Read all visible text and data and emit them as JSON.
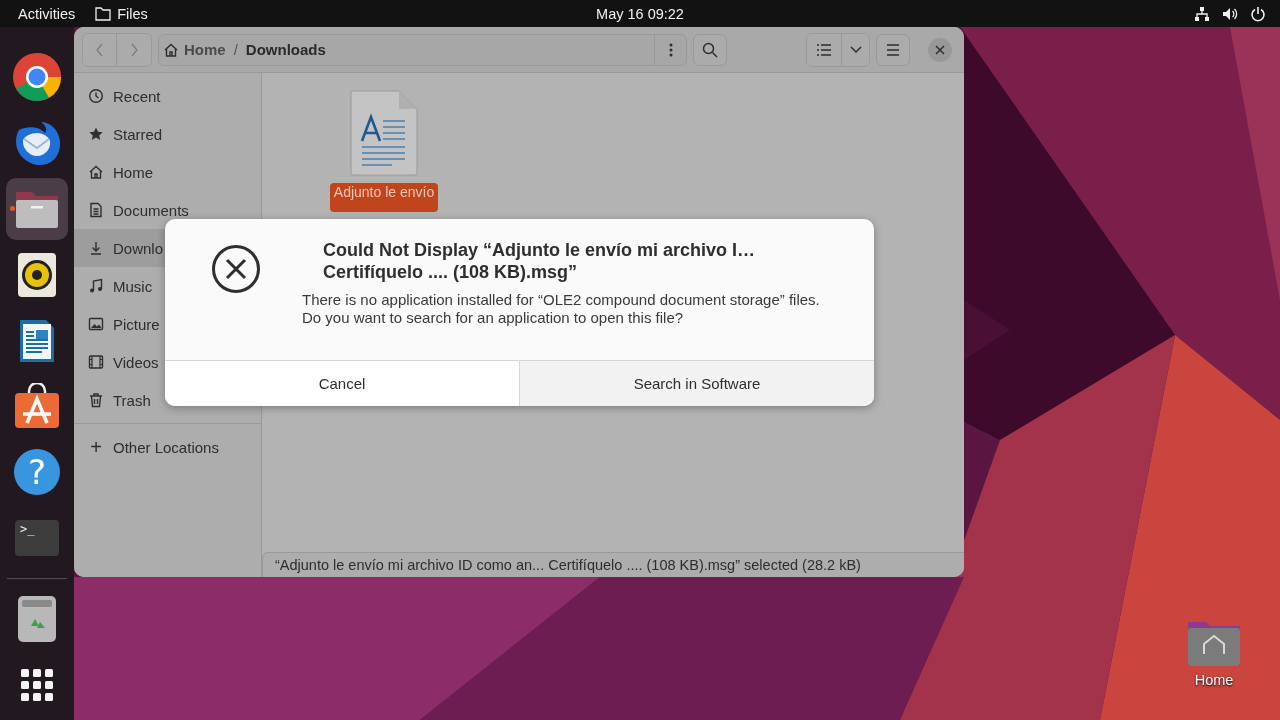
{
  "top_bar": {
    "activities": "Activities",
    "app_name": "Files",
    "clock": "May 16  09:22"
  },
  "dock": {
    "items": [
      {
        "kind": "chrome",
        "active": false
      },
      {
        "kind": "thunderbird",
        "active": false
      },
      {
        "kind": "files",
        "active": true
      },
      {
        "kind": "rhythmbox",
        "active": false
      },
      {
        "kind": "writer",
        "active": false
      },
      {
        "kind": "appcenter",
        "active": false
      },
      {
        "kind": "help",
        "glyph": "?",
        "active": false
      },
      {
        "kind": "terminal",
        "glyph": ">_",
        "active": false
      },
      {
        "kind": "separator"
      },
      {
        "kind": "trash",
        "active": false
      },
      {
        "kind": "apps",
        "active": false
      }
    ]
  },
  "window": {
    "nav": [
      {
        "kind": "back",
        "disabled": true
      },
      {
        "kind": "forward",
        "disabled": true
      }
    ],
    "path": [
      {
        "kind": "home",
        "label": "Home"
      },
      {
        "kind": "folder",
        "label": "Downloads"
      }
    ],
    "separator": "/",
    "sidebar": {
      "items": [
        {
          "label": "Recent",
          "selected": false
        },
        {
          "label": "Starred",
          "selected": false
        },
        {
          "label": "Home",
          "selected": false
        },
        {
          "label": "Documents",
          "selected": false
        },
        {
          "label": "Downlo",
          "selected": true
        },
        {
          "label": "Music",
          "selected": false
        },
        {
          "label": "Picture",
          "selected": false
        },
        {
          "label": "Videos",
          "selected": false
        },
        {
          "label": "Trash",
          "selected": false
        }
      ],
      "other": {
        "glyph": "+",
        "label": "Other Locations"
      }
    },
    "files": [
      {
        "name": "Adjunto le envío",
        "selected": true
      }
    ],
    "status_bar": "“Adjunto le envío mi archivo ID como an... Certifíquelo .... (108 KB).msg” selected (28.2 kB)"
  },
  "dialog": {
    "title_lines": [
      "Could Not Display “Adjunto le envío mi archivo I…",
      "Certifíquelo .... (108 KB).msg”"
    ],
    "message": "There is no application installed for “OLE2 compound document storage” files. Do you want to search for an application to open this file?",
    "buttons": [
      {
        "kind": "cancel",
        "label": "Cancel"
      },
      {
        "kind": "suggested",
        "label": "Search in Software"
      }
    ]
  },
  "desktop": {
    "icons": [
      {
        "label": "Home"
      }
    ]
  }
}
